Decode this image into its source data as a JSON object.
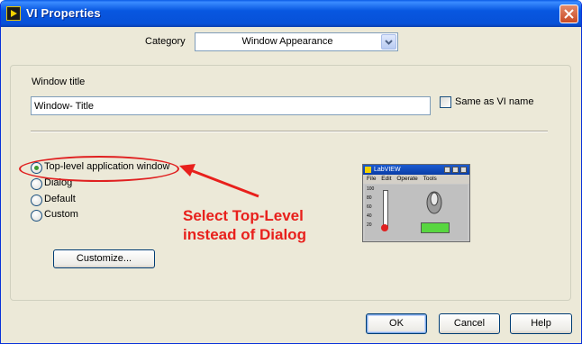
{
  "window": {
    "title": "VI Properties"
  },
  "category": {
    "label": "Category",
    "selected": "Window Appearance"
  },
  "window_title": {
    "label": "Window title",
    "value": "Window- Title"
  },
  "same_as_vi_name": {
    "label": "Same as VI name",
    "checked": false
  },
  "window_type": {
    "options": [
      {
        "label": "Top-level application window",
        "checked": true
      },
      {
        "label": "Dialog",
        "checked": false
      },
      {
        "label": "Default",
        "checked": false
      },
      {
        "label": "Custom",
        "checked": false
      }
    ]
  },
  "customize_label": "Customize...",
  "annotation": {
    "line1": "Select Top-Level",
    "line2": "instead of Dialog",
    "color": "#e8201c"
  },
  "preview": {
    "title": "LabVIEW",
    "menu": [
      "File",
      "Edit",
      "Operate",
      "Tools"
    ],
    "scale": [
      "100",
      "80",
      "60",
      "40",
      "20",
      "0"
    ]
  },
  "buttons": {
    "ok": "OK",
    "cancel": "Cancel",
    "help": "Help"
  }
}
